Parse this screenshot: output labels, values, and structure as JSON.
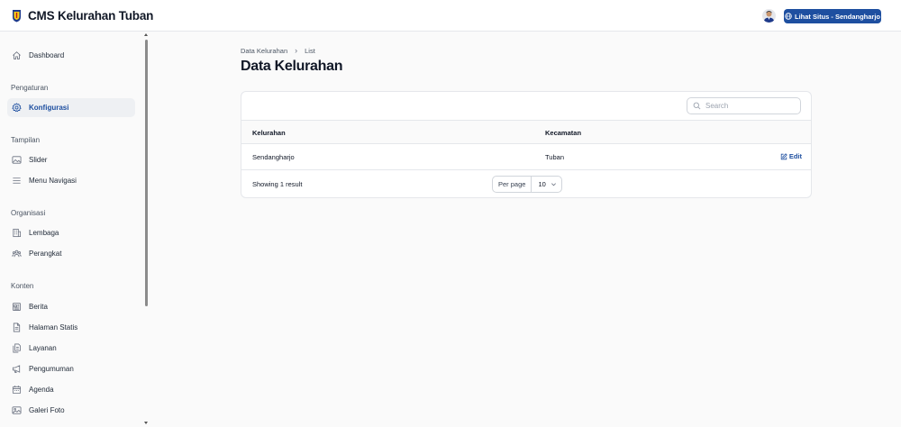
{
  "header": {
    "app_title": "CMS Kelurahan Tuban",
    "site_button": "Lihat Situs - Sendangharjo"
  },
  "sidebar": {
    "items": [
      {
        "label": "Dashboard",
        "icon": "home-icon"
      },
      {
        "label": "Konfigurasi",
        "icon": "gear-icon",
        "active": true
      },
      {
        "label": "Slider",
        "icon": "image-icon"
      },
      {
        "label": "Menu Navigasi",
        "icon": "menu-icon"
      },
      {
        "label": "Lembaga",
        "icon": "building-icon"
      },
      {
        "label": "Perangkat",
        "icon": "users-icon"
      },
      {
        "label": "Berita",
        "icon": "newspaper-icon"
      },
      {
        "label": "Halaman Statis",
        "icon": "document-icon"
      },
      {
        "label": "Layanan",
        "icon": "documents-icon"
      },
      {
        "label": "Pengumuman",
        "icon": "megaphone-icon"
      },
      {
        "label": "Agenda",
        "icon": "calendar-icon"
      },
      {
        "label": "Galeri Foto",
        "icon": "photo-icon"
      }
    ],
    "groups": {
      "pengaturan": "Pengaturan",
      "tampilan": "Tampilan",
      "organisasi": "Organisasi",
      "konten": "Konten"
    }
  },
  "main": {
    "breadcrumb": [
      "Data Kelurahan",
      "List"
    ],
    "title": "Data Kelurahan",
    "search_placeholder": "Search",
    "table": {
      "columns": [
        "Kelurahan",
        "Kecamatan"
      ],
      "rows": [
        {
          "kelurahan": "Sendangharjo",
          "kecamatan": "Tuban",
          "action": "Edit"
        }
      ]
    },
    "footer": {
      "result_text": "Showing 1 result",
      "per_page_label": "Per page",
      "per_page_value": "10"
    }
  },
  "colors": {
    "accent": "#1e4fa0",
    "background": "#fafafa"
  }
}
